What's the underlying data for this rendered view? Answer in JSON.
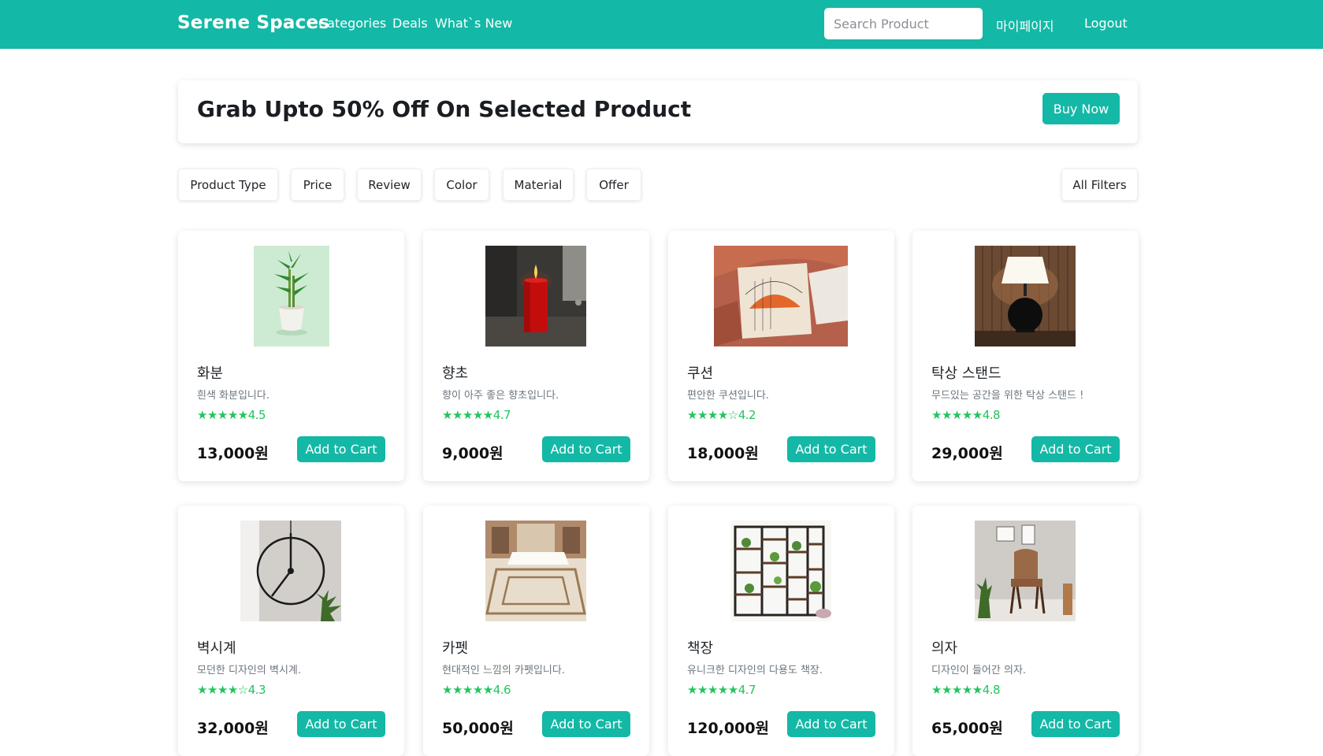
{
  "navbar": {
    "brand": "Serene Spaces",
    "links": [
      "Categories",
      "Deals",
      "What`s New"
    ],
    "search_placeholder": "Search Product",
    "mypage": "마이페이지",
    "logout": "Logout",
    "color": "#14b8a6"
  },
  "banner": {
    "title": "Grab Upto 50% Off On Selected Product",
    "button": "Buy Now"
  },
  "filters": [
    "Product Type",
    "Price",
    "Review",
    "Color",
    "Material",
    "Offer"
  ],
  "all_filters": "All Filters",
  "add_to_cart_label": "Add to Cart",
  "products": [
    {
      "name": "화분",
      "desc": "흰색 화분입니다.",
      "stars": "★★★★★",
      "rating": "4.5",
      "price": "13,000원",
      "image": "bamboo-plant-pot"
    },
    {
      "name": "향초",
      "desc": "향이 아주 좋은 향초입니다.",
      "stars": "★★★★★",
      "rating": "4.7",
      "price": "9,000원",
      "image": "red-candle"
    },
    {
      "name": "쿠션",
      "desc": "편안한 쿠션입니다.",
      "stars": "★★★★☆",
      "rating": "4.2",
      "price": "18,000원",
      "image": "cushion"
    },
    {
      "name": "탁상 스탠드",
      "desc": "무드있는 공간을 위한 탁상 스탠드 !",
      "stars": "★★★★★",
      "rating": "4.8",
      "price": "29,000원",
      "image": "table-lamp"
    },
    {
      "name": "벽시계",
      "desc": "모던한 디자인의 벽시계.",
      "stars": "★★★★☆",
      "rating": "4.3",
      "price": "32,000원",
      "image": "wall-clock"
    },
    {
      "name": "카펫",
      "desc": "현대적인 느낌의 카펫입니다.",
      "stars": "★★★★★",
      "rating": "4.6",
      "price": "50,000원",
      "image": "carpet-room"
    },
    {
      "name": "책장",
      "desc": "유니크한 디자인의 다용도 책장.",
      "stars": "★★★★★",
      "rating": "4.7",
      "price": "120,000원",
      "image": "bookshelf"
    },
    {
      "name": "의자",
      "desc": "디자인이 들어간 의자.",
      "stars": "★★★★★",
      "rating": "4.8",
      "price": "65,000원",
      "image": "chair"
    }
  ]
}
